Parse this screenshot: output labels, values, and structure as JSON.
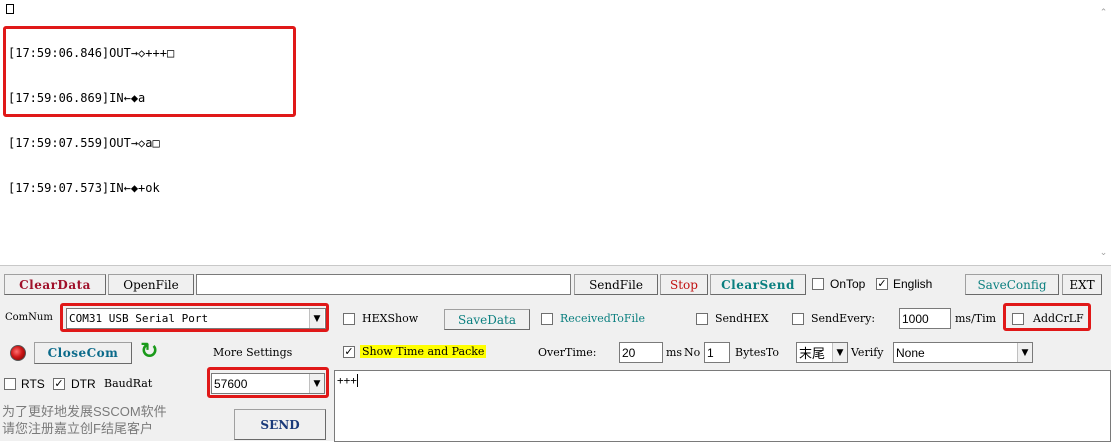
{
  "log": {
    "lines": [
      "[17:59:06.846]OUT→◇+++□",
      "[17:59:06.869]IN←◆a",
      "[17:59:07.559]OUT→◇a□",
      "[17:59:07.573]IN←◆+ok"
    ]
  },
  "toolbar": {
    "clear_data": "ClearData",
    "open_file": "OpenFile",
    "file_path": "",
    "send_file": "SendFile",
    "stop": "Stop",
    "clear_send": "ClearSend",
    "on_top": "OnTop",
    "english": "English",
    "save_config": "SaveConfig",
    "ext": "EXT"
  },
  "port": {
    "com_num_label": "ComNum",
    "com_value": "COM31 USB Serial Port",
    "close_com": "CloseCom",
    "more_settings": "More Settings",
    "rts": "RTS",
    "dtr": "DTR",
    "baud_label": "BaudRat",
    "baud_value": "57600"
  },
  "options": {
    "hex_show": "HEXShow",
    "save_data": "SaveData",
    "received_to_file": "ReceivedToFile",
    "send_hex": "SendHEX",
    "send_every": "SendEvery:",
    "send_every_value": "1000",
    "ms_tim": "ms/Tim",
    "add_crlf": "AddCrLF",
    "show_time": "Show Time and Packe",
    "overtime": "OverTime:",
    "overtime_value": "20",
    "ms": "ms",
    "no": "No",
    "no_value": "1",
    "bytes_to": "BytesTo",
    "tail_value": "末尾",
    "verify": "Verify",
    "verify_value": "None"
  },
  "send": {
    "input_value": "+++",
    "send_button": "SEND"
  },
  "promo": {
    "line1": "为了更好地发展SSCOM软件",
    "line2": "请您注册嘉立创F结尾客户"
  },
  "colors": {
    "highlight": "#e01818",
    "show_time_bg": "#ffff00",
    "accent_red": "#a0102a",
    "accent_teal": "#0a7f7f"
  }
}
